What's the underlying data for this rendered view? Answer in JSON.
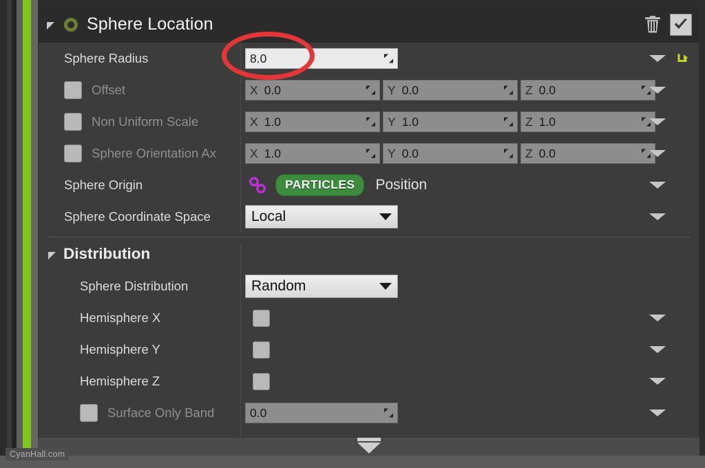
{
  "window": {
    "watermark": "CyanHall.com"
  },
  "panel": {
    "title": "Sphere Location",
    "collapse_icon": "triangle-collapse-icon",
    "module_icon": "green-ring-icon",
    "delete_icon": "trash-icon",
    "enabled_checkbox": "checkbox-checked",
    "enabled": true
  },
  "annotation": {
    "shape": "ellipse",
    "color": "#e33636",
    "targets": "sphere-radius-field"
  },
  "rows": [
    {
      "name": "sphere-radius",
      "label": "Sphere Radius",
      "dim": false,
      "has_checkbox": false,
      "type": "number",
      "value": "8.0",
      "active": true,
      "has_chevron": true,
      "has_revert": true
    },
    {
      "name": "offset",
      "label": "Offset",
      "dim": true,
      "has_checkbox": true,
      "type": "vector",
      "x_axis": "X",
      "x_value": "0.0",
      "y_axis": "Y",
      "y_value": "0.0",
      "z_axis": "Z",
      "z_value": "0.0",
      "has_chevron": true,
      "has_revert": false
    },
    {
      "name": "non-uniform-scale",
      "label": "Non Uniform Scale",
      "dim": true,
      "has_checkbox": true,
      "type": "vector",
      "x_axis": "X",
      "x_value": "1.0",
      "y_axis": "Y",
      "y_value": "1.0",
      "z_axis": "Z",
      "z_value": "1.0",
      "has_chevron": true,
      "has_revert": false
    },
    {
      "name": "sphere-orientation-axis",
      "label": "Sphere Orientation Ax",
      "dim": true,
      "has_checkbox": true,
      "type": "vector",
      "x_axis": "X",
      "x_value": "1.0",
      "y_axis": "Y",
      "y_value": "0.0",
      "z_axis": "Z",
      "z_value": "0.0",
      "has_chevron": true,
      "has_revert": false
    },
    {
      "name": "sphere-origin",
      "label": "Sphere Origin",
      "dim": false,
      "has_checkbox": false,
      "type": "binding",
      "link_icon": "chain-link-icon",
      "namespace_badge": "PARTICLES",
      "binding_value": "Position",
      "badge_color": "#3d8b3d",
      "link_color": "#b832d4",
      "has_chevron": true,
      "has_revert": false
    },
    {
      "name": "sphere-coordinate-space",
      "label": "Sphere Coordinate Space",
      "dim": false,
      "has_checkbox": false,
      "type": "combo",
      "value": "Local",
      "options": [
        "Local"
      ],
      "has_chevron": true,
      "has_revert": false
    }
  ],
  "distribution": {
    "section_title": "Distribution",
    "collapse_icon": "triangle-collapse-icon",
    "rows": [
      {
        "name": "sphere-distribution",
        "label": "Sphere Distribution",
        "dim": false,
        "has_checkbox": false,
        "type": "combo",
        "value": "Random",
        "options": [
          "Random"
        ],
        "has_chevron": false,
        "has_revert": false
      },
      {
        "name": "hemisphere-x",
        "label": "Hemisphere X",
        "dim": false,
        "has_checkbox": false,
        "type": "checkbox",
        "checked": false,
        "has_chevron": true,
        "has_revert": false
      },
      {
        "name": "hemisphere-y",
        "label": "Hemisphere Y",
        "dim": false,
        "has_checkbox": false,
        "type": "checkbox",
        "checked": false,
        "has_chevron": true,
        "has_revert": false
      },
      {
        "name": "hemisphere-z",
        "label": "Hemisphere Z",
        "dim": false,
        "has_checkbox": false,
        "type": "checkbox",
        "checked": false,
        "has_chevron": true,
        "has_revert": false
      },
      {
        "name": "surface-only-band",
        "label": "Surface Only Band",
        "dim": true,
        "has_checkbox": true,
        "type": "number",
        "value": "0.0",
        "active": false,
        "has_chevron": true,
        "has_revert": false
      }
    ]
  },
  "bottom_bar": {
    "expander_icon": "expand-down-icon"
  }
}
